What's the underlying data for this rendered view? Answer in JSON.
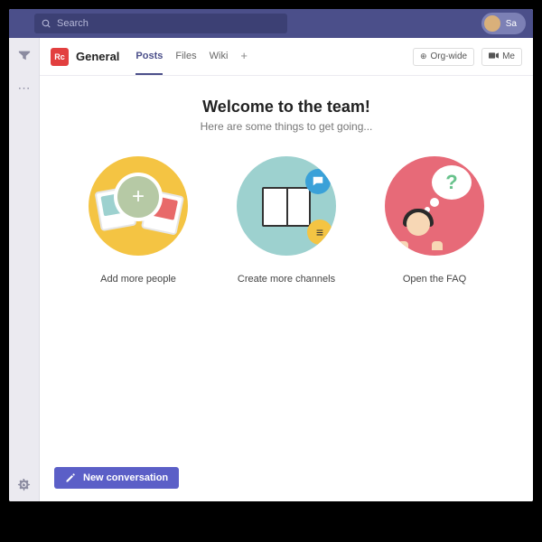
{
  "titlebar": {
    "search_placeholder": "Search",
    "user_initials": "Sa"
  },
  "channel": {
    "icon_text": "Rc",
    "name": "General",
    "tabs": [
      "Posts",
      "Files",
      "Wiki"
    ],
    "active_tab_index": 0,
    "scope_button": "Org-wide",
    "meet_button": "Me"
  },
  "welcome": {
    "title": "Welcome to the team!",
    "subtitle": "Here are some things to get going...",
    "cards": [
      {
        "label": "Add more people"
      },
      {
        "label": "Create more channels"
      },
      {
        "label": "Open the FAQ"
      }
    ]
  },
  "compose": {
    "button_label": "New conversation"
  }
}
